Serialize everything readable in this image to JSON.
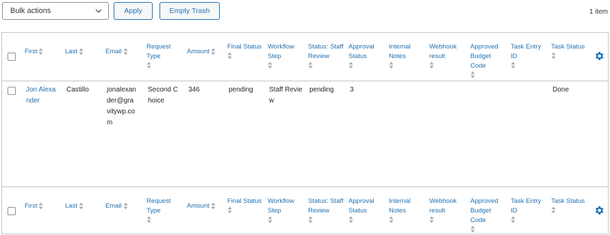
{
  "toolbar": {
    "bulk_actions": "Bulk actions",
    "apply": "Apply",
    "empty_trash": "Empty Trash",
    "item_count": "1 item"
  },
  "columns": {
    "first": "First",
    "last": "Last",
    "email": "Email",
    "request_type": "Request Type",
    "amount": "Amount",
    "final_status": "Final Status",
    "workflow_step": "Workflow Step",
    "status_staff_review": "Status: Staff Review",
    "approval_status": "Approval Status",
    "internal_notes": "Internal Notes",
    "webhook_result": "Webhook result",
    "approved_budget_code": "Approved Budget Code",
    "task_entry_id": "Task Entry ID",
    "task_status": "Task Status"
  },
  "rows": [
    {
      "first": "Jon Alexander",
      "last": "Castillo",
      "email": "jonalexander@gravitywp.com",
      "request_type": "Second Choice",
      "amount": "346",
      "final_status": "pending",
      "workflow_step": "Staff Review",
      "status_staff_review": "pending",
      "approval_status": "3",
      "internal_notes": "",
      "webhook_result": "",
      "approved_budget_code": "",
      "task_entry_id": "",
      "task_status": "Done"
    }
  ],
  "colors": {
    "link": "#2271b1",
    "border": "#c3c4c7",
    "text": "#1d2327"
  },
  "icons": {
    "settings": "gear-icon",
    "sort": "sort-arrows-icon",
    "dropdown": "chevron-down-icon"
  }
}
